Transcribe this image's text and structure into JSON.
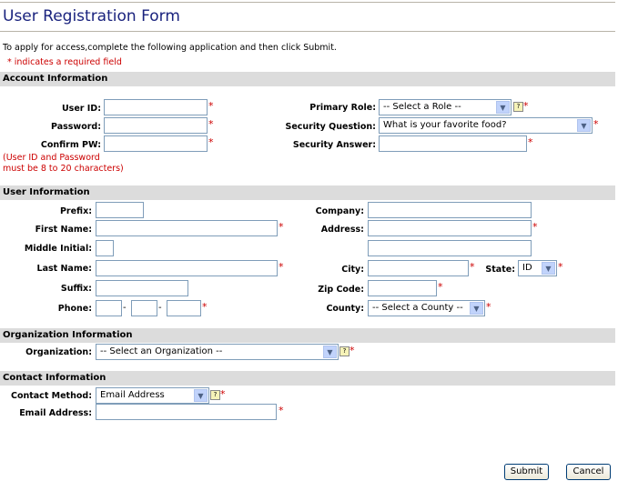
{
  "header": {
    "title": "User Registration Form",
    "intro": "To apply for access,complete the following application and then click Submit.",
    "required_note": "* indicates a required field"
  },
  "required_marker": "*",
  "help_icon_glyph": "?",
  "dropdown_arrow_glyph": "▼",
  "account": {
    "heading": "Account Information",
    "user_id_label": "User ID:",
    "password_label": "Password:",
    "confirm_label": "Confirm PW:",
    "pw_note_line1": "(User ID and Password",
    "pw_note_line2": "must be 8 to 20 characters)",
    "role_label": "Primary Role:",
    "role_value": "-- Select a Role --",
    "question_label": "Security Question:",
    "question_value": "What is your favorite food?",
    "answer_label": "Security Answer:"
  },
  "user": {
    "heading": "User Information",
    "prefix_label": "Prefix:",
    "first_label": "First Name:",
    "middle_label": "Middle Initial:",
    "last_label": "Last Name:",
    "suffix_label": "Suffix:",
    "phone_label": "Phone:",
    "phone_sep": "-",
    "company_label": "Company:",
    "address_label": "Address:",
    "city_label": "City:",
    "state_label": "State:",
    "state_value": "ID",
    "zip_label": "Zip Code:",
    "county_label": "County:",
    "county_value": "-- Select a County --"
  },
  "organization": {
    "heading": "Organization Information",
    "org_label": "Organization:",
    "org_value": "-- Select an Organization --"
  },
  "contact": {
    "heading": "Contact Information",
    "method_label": "Contact Method:",
    "method_value": "Email Address",
    "email_label": "Email Address:"
  },
  "buttons": {
    "submit": "Submit",
    "cancel": "Cancel"
  }
}
